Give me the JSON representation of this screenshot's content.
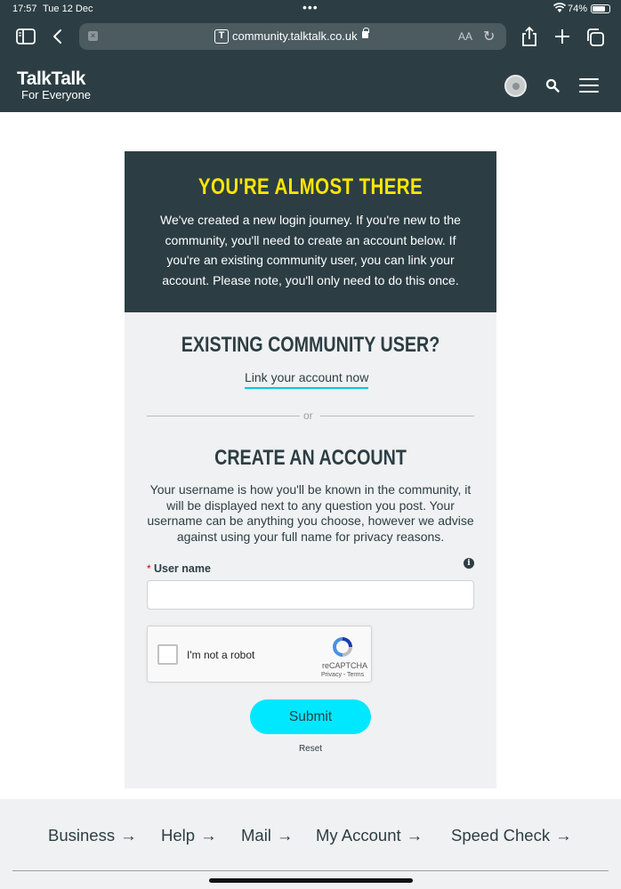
{
  "status_bar": {
    "time": "17:57",
    "date": "Tue 12 Dec",
    "battery": "74%"
  },
  "browser": {
    "url": "community.talktalk.co.uk",
    "site_initial": "T",
    "text_size": "AA"
  },
  "header": {
    "logo": "TalkTalk",
    "tagline": "For Everyone"
  },
  "almost": {
    "title": "YOU'RE ALMOST THERE",
    "text": "We've created a new login journey. If you're new to the community, you'll need to create an account below. If you're an existing community user, you can link your account. Please note, you'll only need to do this once."
  },
  "existing": {
    "title": "EXISTING COMMUNITY USER?",
    "link": "Link your account now"
  },
  "divider": "or",
  "create": {
    "title": "CREATE AN ACCOUNT",
    "text": "Your username is how you'll be known in the community, it will be displayed next to any question you post. Your username can be anything you choose, however we advise against using your full name for privacy reasons.",
    "username_label": "User name",
    "required_mark": "*",
    "username_value": ""
  },
  "recaptcha": {
    "label": "I'm not a robot",
    "brand": "reCAPTCHA",
    "links": "Privacy - Terms"
  },
  "form": {
    "submit": "Submit",
    "reset": "Reset"
  },
  "footer": {
    "links": [
      {
        "label": "Business",
        "arrow": "→"
      },
      {
        "label": "Help",
        "arrow": "→"
      },
      {
        "label": "Mail",
        "arrow": "→"
      },
      {
        "label": "My Account",
        "arrow": "→"
      },
      {
        "label": "Speed Check",
        "arrow": "→"
      }
    ]
  },
  "colors": {
    "brand_dark": "#2c3e44",
    "accent_yellow": "#ffe600",
    "accent_cyan": "#00e8ff",
    "panel": "#f0f1f2"
  }
}
